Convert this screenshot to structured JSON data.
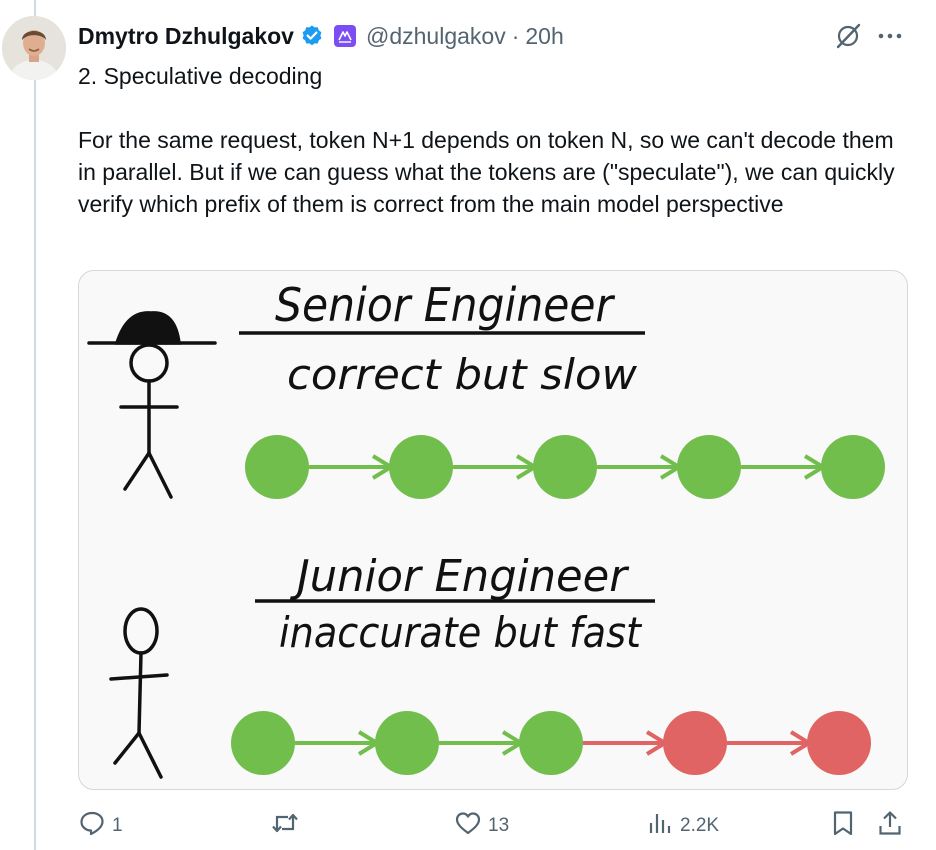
{
  "author": {
    "name": "Dmytro Dzhulgakov",
    "handle": "@dzhulgakov",
    "separator": "·",
    "timestamp": "20h",
    "verified_color": "#1d9bf0"
  },
  "tweet": {
    "title": "2. Speculative decoding",
    "body": "For the same request, token N+1 depends on token N, so we can't decode them in parallel. But if we can guess what the tokens are (\"speculate\"), we can quickly verify which prefix of them is correct from the main model perspective"
  },
  "image": {
    "senior_title": "Senior Engineer",
    "senior_subtitle": "correct but slow",
    "junior_title": "Junior Engineer",
    "junior_subtitle": "inaccurate but fast",
    "correct_token_color": "#72be4c",
    "wrong_token_color": "#e06464",
    "senior_token_count": 5,
    "junior_correct_count": 3,
    "junior_wrong_count": 2
  },
  "actions": {
    "reply_count": "1",
    "retweet_count": "",
    "like_count": "13",
    "views_count": "2.2K"
  },
  "icons": {
    "verified": "verified-badge-icon",
    "affiliate": "affiliate-badge-icon",
    "grok": "grok-icon",
    "more": "more-icon",
    "reply": "reply-icon",
    "retweet": "retweet-icon",
    "like": "heart-icon",
    "views": "views-icon",
    "bookmark": "bookmark-icon",
    "share": "share-icon"
  }
}
